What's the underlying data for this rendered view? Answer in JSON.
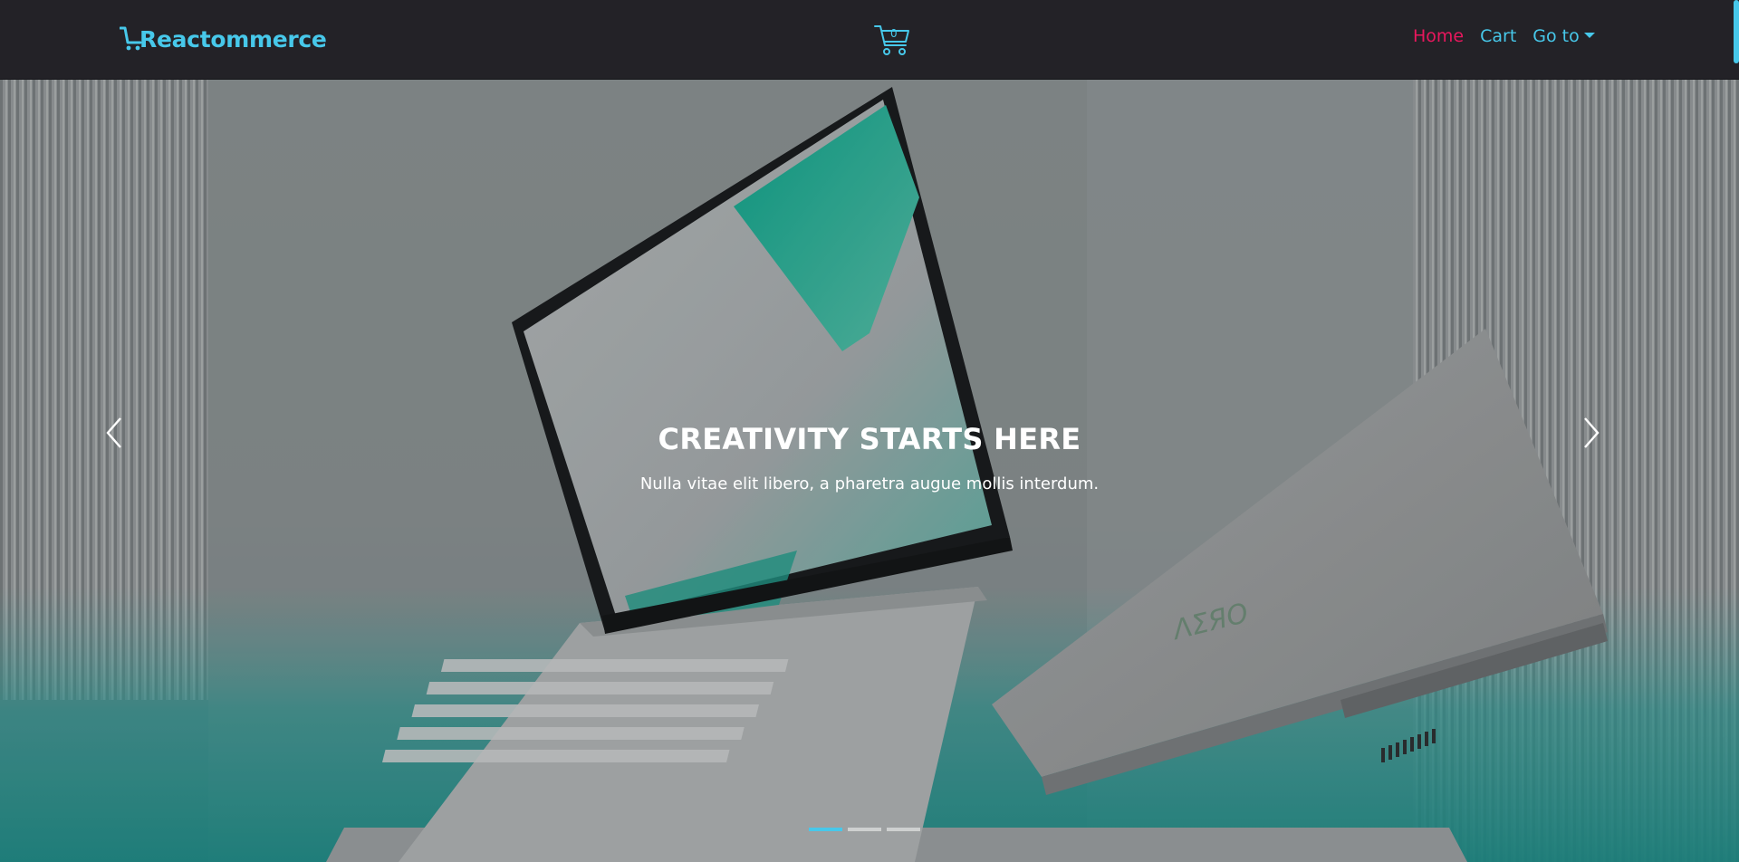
{
  "brand": {
    "name": "Reactommerce",
    "icon": "cart-icon"
  },
  "cart": {
    "count": "0",
    "icon": "cart-icon"
  },
  "nav": {
    "home": "Home",
    "cart": "Cart",
    "goto": "Go to"
  },
  "carousel": {
    "title": "CREATIVITY STARTS HERE",
    "subtitle": "Nulla vitae elit libero, a pharetra augue mollis interdum.",
    "active_slide": 1,
    "slide_count": 3,
    "prev_icon": "chevron-left-icon",
    "next_icon": "chevron-right-icon"
  },
  "colors": {
    "navbar_bg": "#232227",
    "accent": "#47c8ea",
    "active_link": "#e8175d"
  }
}
